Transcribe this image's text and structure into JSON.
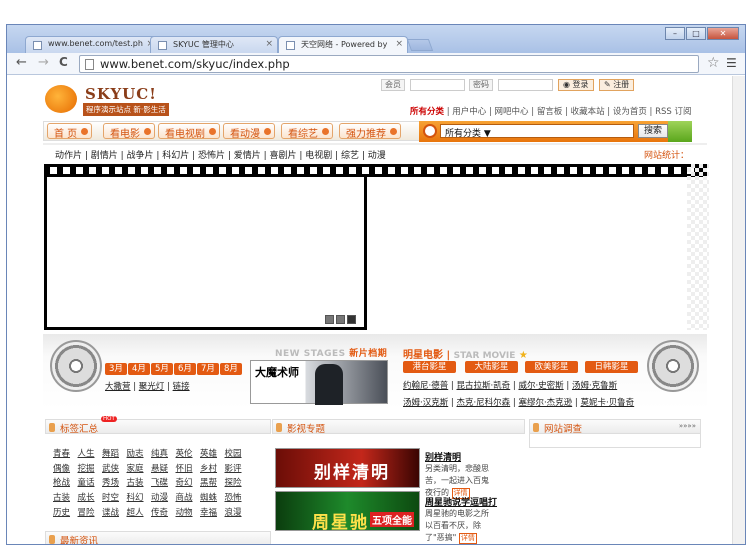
{
  "browser": {
    "tabs": [
      {
        "title": "www.benet.com/test.ph"
      },
      {
        "title": "SKYUC 管理中心"
      },
      {
        "title": "天空网络 - Powered by"
      }
    ],
    "window_buttons": {
      "minimize": "–",
      "maximize": "□",
      "close": "✕"
    },
    "url": "www.benet.com/skyuc/index.php",
    "nav": {
      "back": "←",
      "forward": "→",
      "reload": "C"
    }
  },
  "header": {
    "logo_text": "SKYUC!",
    "slogan": "程序演示站点 新·影生活",
    "login": {
      "member_label": "会员",
      "password_label": "密码",
      "login_btn": "登录",
      "register_btn": "注册"
    },
    "toplinks": {
      "all": "所有分类",
      "rest": " | 用户中心 | 网吧中心 | 留言板 | 收藏本站 | 设为首页 | RSS 订阅"
    }
  },
  "nav": {
    "items": [
      "首 页",
      "看电影",
      "看电视剧",
      "看动漫",
      "看综艺",
      "强力推荐"
    ],
    "search": {
      "category": "所有分类",
      "arrow": "▼",
      "button": "搜索"
    }
  },
  "categories": {
    "text": "动作片 | 剧情片 | 战争片 | 科幻片 | 恐怖片 | 爱情片 | 喜剧片 | 电视剧 | 综艺 | 动漫",
    "stat": "网站统计："
  },
  "player": {
    "controls": [
      "◀",
      "■",
      "▶"
    ]
  },
  "months": {
    "items": [
      "3月",
      "4月",
      "5月",
      "6月",
      "7月",
      "8月"
    ],
    "links": [
      "大撒营",
      "聚光灯",
      "链接"
    ]
  },
  "newstages": {
    "label": "NEW STAGES",
    "highlight": "新片档期"
  },
  "poster": {
    "title": "大魔术师"
  },
  "stars": {
    "title": "明星电影",
    "subtitle": "STAR MOVIE",
    "categories": [
      "港台影星",
      "大陆影星",
      "欧美影星",
      "日韩影星"
    ],
    "row1": [
      "约翰尼·德普",
      "昆古拉斯·凯奇",
      "威尔·史密斯",
      "汤姆·克鲁斯"
    ],
    "row2": [
      "汤姆·汉克斯",
      "杰克·尼科尔森",
      "塞缪尔·杰克逊",
      "莫妮卡·贝鲁奇"
    ]
  },
  "tags": {
    "title": "标签汇总",
    "hot": "HOT",
    "rows": [
      [
        "青春",
        "人生",
        "舞蹈",
        "励志",
        "纯真",
        "英伦",
        "英雄",
        "校园"
      ],
      [
        "偶像",
        "挖掘",
        "武侠",
        "家庭",
        "悬疑",
        "怀旧",
        "乡村",
        "影评"
      ],
      [
        "枪战",
        "童话",
        "秀场",
        "古装",
        "飞碟",
        "奇幻",
        "黑帮",
        "探险"
      ],
      [
        "古装",
        "成长",
        "时空",
        "科幻",
        "动漫",
        "商战",
        "蜘蛛",
        "恐怖"
      ],
      [
        "历史",
        "冒险",
        "谍战",
        "超人",
        "传奇",
        "动物",
        "幸福",
        "浪漫"
      ]
    ],
    "more_title": "最新资讯"
  },
  "topics": {
    "title": "影视专题",
    "items": [
      {
        "ad_text": "别样清明",
        "title": "别样清明",
        "desc": "另类清明，悲酸思苦，一起进入百鬼夜行的",
        "detail": "详情"
      },
      {
        "ad_text": "周星驰",
        "ad_sub": "五项全能",
        "title": "周星驰说学逗唱打",
        "desc": "周星驰的电影之所以百看不厌，除了\"恶搞\"",
        "detail": "详情"
      }
    ]
  },
  "survey": {
    "title": "网站调查",
    "more": "»»»»"
  }
}
